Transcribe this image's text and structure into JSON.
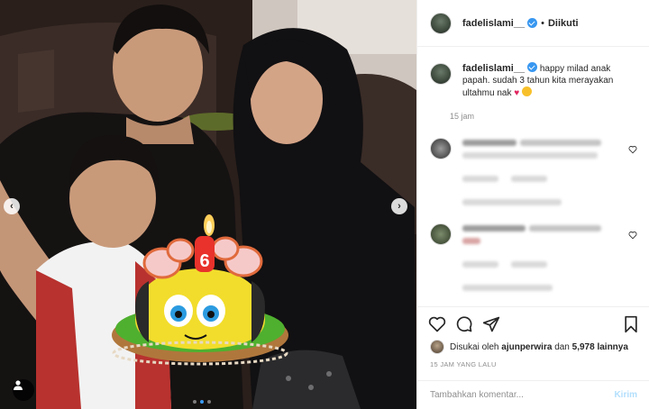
{
  "post": {
    "username": "fadelislami__",
    "separator": "•",
    "follow_label": "Diikuti",
    "caption": "happy milad anak papah. sudah 3 tahun kita merayakan ultahmu nak",
    "caption_emojis": [
      "red-heart",
      "smiling-face"
    ],
    "caption_time": "15 jam",
    "cake_candle_number": "6",
    "carousel": {
      "slides": 3,
      "active_index": 1
    }
  },
  "comments": [
    {
      "author": "hidden",
      "text": "hidden (blurred)"
    },
    {
      "author": "hidden",
      "text": "hidden (blurred)"
    }
  ],
  "likes": {
    "prefix": "Disukai oleh",
    "user": "ajunperwira",
    "conjunction": "dan",
    "count": "5,978 lainnya"
  },
  "posted_ago": "15 JAM YANG LALU",
  "comment_box": {
    "placeholder": "Tambahkan komentar...",
    "send_label": "Kirim"
  },
  "colors": {
    "verified": "#3897f0",
    "send_disabled": "#b2dffc",
    "secondary_text": "#8e8e8e",
    "border": "#efefef"
  },
  "icons": [
    "verified-badge-icon",
    "heart-icon",
    "comment-icon",
    "share-icon",
    "bookmark-icon",
    "user-tag-icon",
    "chevron-left-icon",
    "chevron-right-icon"
  ]
}
